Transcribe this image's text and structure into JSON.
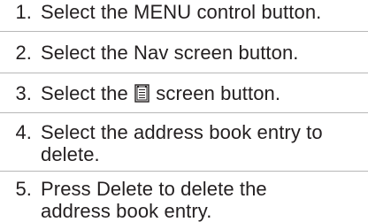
{
  "steps": [
    {
      "number": "1.",
      "text": "Select the MENU control button."
    },
    {
      "number": "2.",
      "text": "Select the Nav screen button."
    },
    {
      "number": "3.",
      "text_before": "Select the",
      "icon": "address-book-icon",
      "text_after": "screen button."
    },
    {
      "number": "4.",
      "line1": "Select the address book entry to",
      "line2": "delete."
    },
    {
      "number": "5.",
      "line1": "Press Delete to delete the",
      "line2": "address book entry."
    }
  ]
}
